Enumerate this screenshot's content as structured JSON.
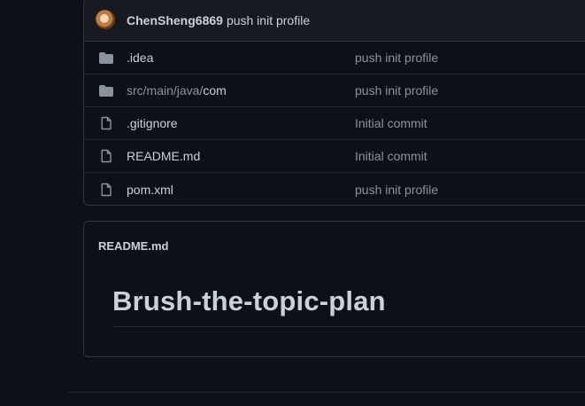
{
  "commit": {
    "author": "ChenSheng6869",
    "message": "push init profile"
  },
  "files": [
    {
      "type": "folder",
      "icon": "folder-icon",
      "name_dim": "",
      "name": ".idea",
      "message": "push init profile"
    },
    {
      "type": "folder",
      "icon": "folder-icon",
      "name_dim": "src/main/java/",
      "name": "com",
      "message": "push init profile"
    },
    {
      "type": "file",
      "icon": "file-icon",
      "name_dim": "",
      "name": ".gitignore",
      "message": "Initial commit"
    },
    {
      "type": "file",
      "icon": "file-icon",
      "name_dim": "",
      "name": "README.md",
      "message": "Initial commit"
    },
    {
      "type": "file",
      "icon": "file-icon",
      "name_dim": "",
      "name": "pom.xml",
      "message": "push init profile"
    }
  ],
  "readme": {
    "filename": "README.md",
    "heading": "Brush-the-topic-plan"
  },
  "colors": {
    "background": "#0d1117",
    "header_bg": "#161b22",
    "border": "#30363d",
    "text": "#c9d1d9",
    "muted": "#8b949e"
  }
}
